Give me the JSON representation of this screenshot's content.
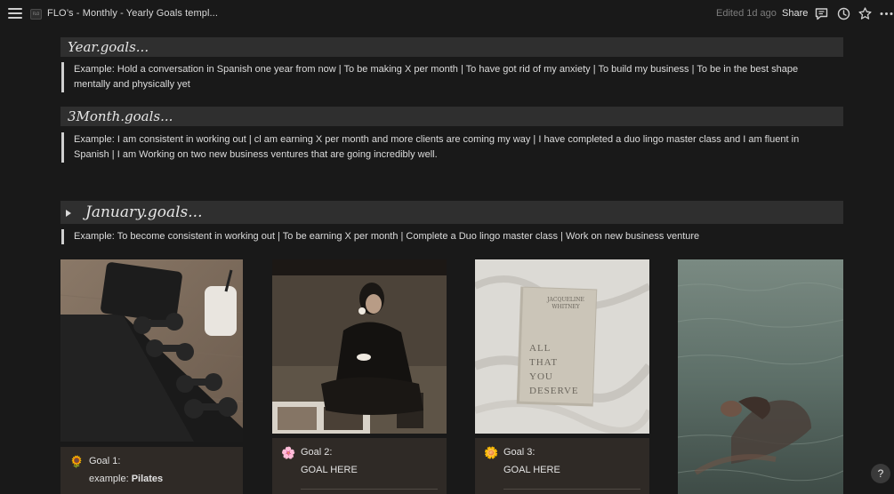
{
  "topbar": {
    "icon_label": "FLO",
    "title": "FLO’s - Monthly - Yearly Goals templ...",
    "edited": "Edited 1d ago",
    "share_label": "Share"
  },
  "sections": {
    "year": {
      "title": "Year.goals...",
      "text": "Example: Hold a conversation in Spanish one year from now | To be making X per month | To have got rid of my anxiety | To build my business | To be in the best shape mentally and physically yet"
    },
    "three_month": {
      "title": "3Month.goals...",
      "text": "Example: I am consistent in working out  | cl am earning X per month and more clients are coming my way | I have completed a duo lingo master class and I am fluent in Spanish | I am Working on two new business ventures that are going incredibly well."
    },
    "january": {
      "title": "January.goals...",
      "text": "Example: To become consistent in working out  | To be earning X per month | Complete a Duo lingo master class | Work on new business venture"
    }
  },
  "book_cover": {
    "author": "JACQUELINE WHITNEY",
    "title_lines": [
      "ALL",
      "THAT",
      "YOU",
      "DESERVE"
    ]
  },
  "goals": [
    {
      "emoji": "🌻",
      "title": "Goal 1:",
      "sub_prefix": "example: ",
      "sub_bold": "Pilates"
    },
    {
      "emoji": "🌸",
      "title": "Goal 2:",
      "sub_prefix": "GOAL HERE",
      "sub_bold": ""
    },
    {
      "emoji": "🌼",
      "title": "Goal 3:",
      "sub_prefix": "GOAL HERE",
      "sub_bold": ""
    }
  ],
  "help_label": "?",
  "icons": [
    "menu-icon",
    "page-icon",
    "comment-icon",
    "history-clock-icon",
    "star-icon",
    "more-dots-icon",
    "toggle-triangle-icon",
    "sunflower-icon",
    "blossom-icon",
    "flower-icon",
    "help-icon"
  ],
  "colors": {
    "background": "#191919",
    "header_bar": "#2f2f2f",
    "card_body": "#2f2a26"
  }
}
